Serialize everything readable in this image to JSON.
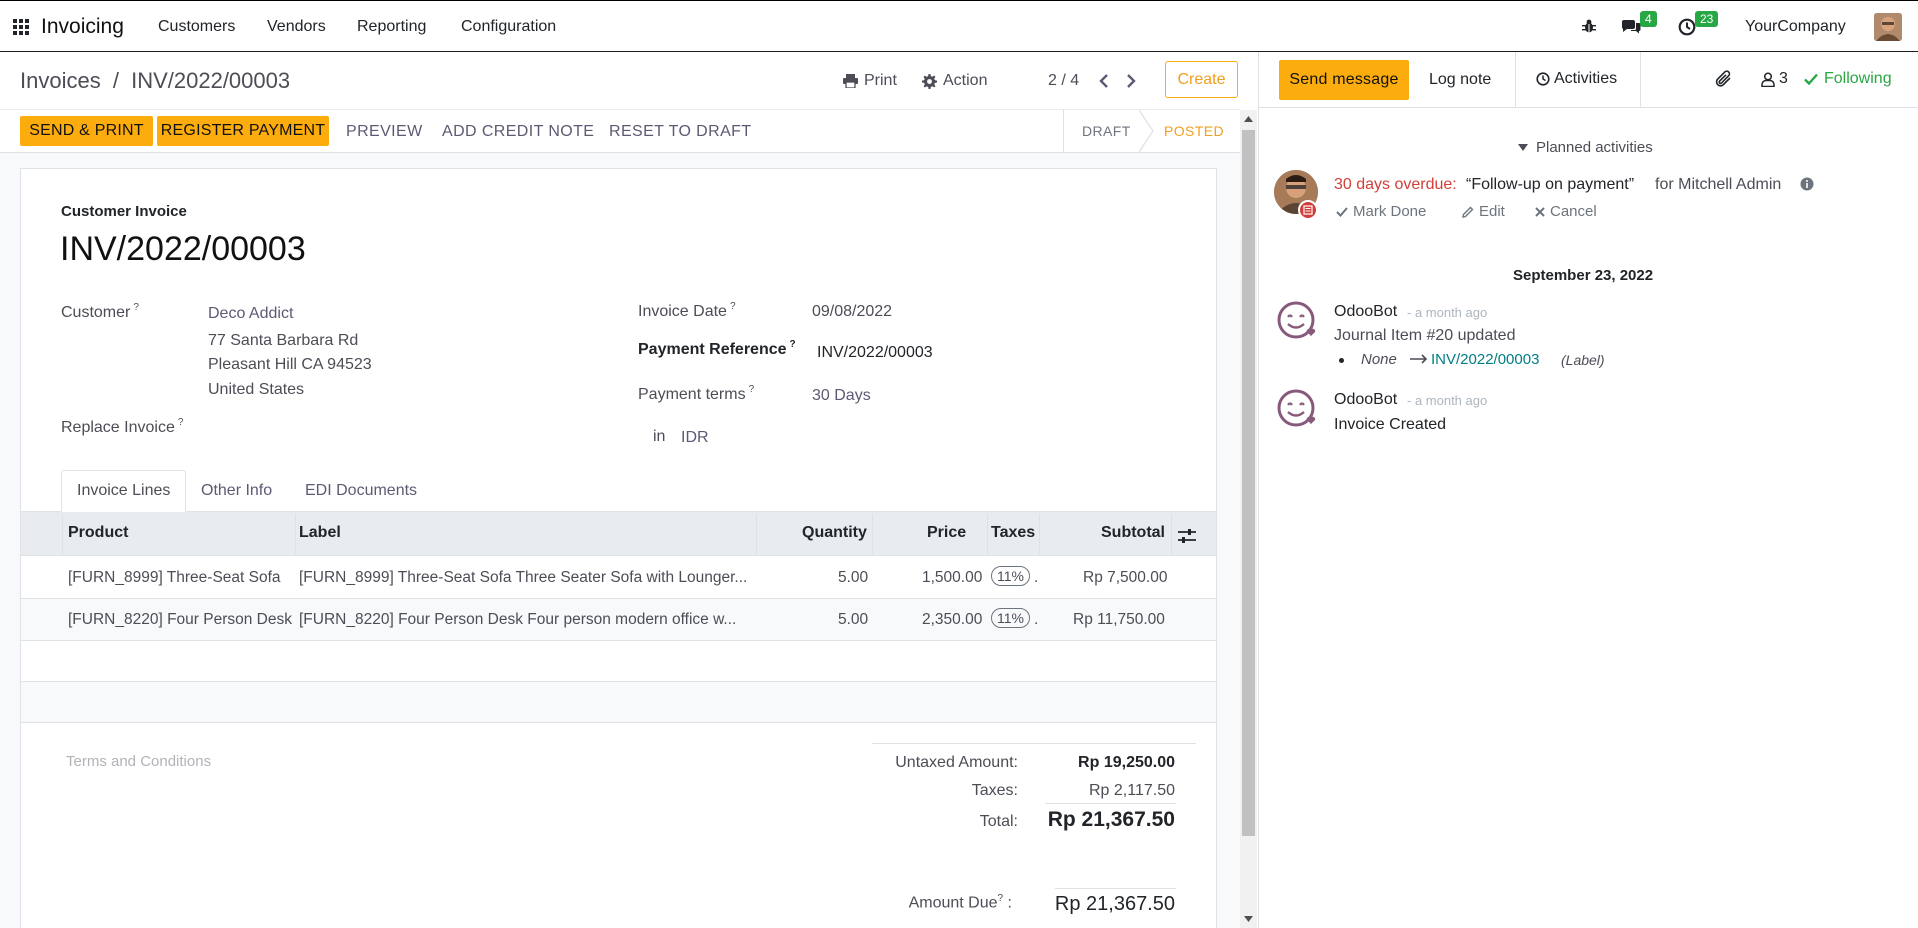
{
  "nav": {
    "app_name": "Invoicing",
    "menu": [
      "Customers",
      "Vendors",
      "Reporting",
      "Configuration"
    ],
    "messages_count": "4",
    "activities_count": "23",
    "company": "YourCompany"
  },
  "control": {
    "breadcrumb_parent": "Invoices",
    "breadcrumb_sep": "/",
    "breadcrumb_current": "INV/2022/00003",
    "print": "Print",
    "action": "Action",
    "pager": "2 / 4",
    "create": "Create"
  },
  "statusbar": {
    "send_print": "SEND & PRINT",
    "register_payment": "REGISTER PAYMENT",
    "preview": "PREVIEW",
    "add_credit_note": "ADD CREDIT NOTE",
    "reset_to_draft": "RESET TO DRAFT",
    "state_draft": "DRAFT",
    "state_posted": "POSTED"
  },
  "invoice": {
    "type_label": "Customer Invoice",
    "number": "INV/2022/00003",
    "customer_label": "Customer",
    "customer_name": "Deco Addict",
    "address_line1": "77 Santa Barbara Rd",
    "address_line2": "Pleasant Hill CA 94523",
    "address_line3": "United States",
    "replace_invoice_label": "Replace Invoice",
    "invoice_date_label": "Invoice Date",
    "invoice_date": "09/08/2022",
    "payment_reference_label": "Payment Reference",
    "payment_reference": "INV/2022/00003",
    "payment_terms_label": "Payment terms",
    "payment_terms": "30 Days",
    "currency_prefix": "in",
    "currency": "IDR",
    "help_mark": "?"
  },
  "tabs": [
    "Invoice Lines",
    "Other Info",
    "EDI Documents"
  ],
  "lines": {
    "headers": {
      "product": "Product",
      "label": "Label",
      "quantity": "Quantity",
      "price": "Price",
      "taxes": "Taxes",
      "subtotal": "Subtotal"
    },
    "rows": [
      {
        "product": "[FURN_8999] Three-Seat Sofa",
        "label": "[FURN_8999] Three-Seat Sofa Three Seater Sofa with Lounger...",
        "quantity": "5.00",
        "price": "1,500.00",
        "tax": "11%",
        "tax_suffix": ".",
        "subtotal": "Rp 7,500.00"
      },
      {
        "product": "[FURN_8220] Four Person Desk",
        "label": "[FURN_8220] Four Person Desk Four person modern office w...",
        "quantity": "5.00",
        "price": "2,350.00",
        "tax": "11%",
        "tax_suffix": ".",
        "subtotal": "Rp 11,750.00"
      }
    ]
  },
  "terms_placeholder": "Terms and Conditions",
  "totals": {
    "untaxed_label": "Untaxed Amount:",
    "untaxed": "Rp 19,250.00",
    "taxes_label": "Taxes:",
    "taxes": "Rp 2,117.50",
    "total_label": "Total:",
    "total": "Rp 21,367.50",
    "amount_due_label": "Amount Due",
    "amount_due_colon": ":",
    "amount_due": "Rp 21,367.50"
  },
  "chatter": {
    "send_message": "Send message",
    "log_note": "Log note",
    "activities": "Activities",
    "followers_count": "3",
    "following": "Following",
    "planned_activities": "Planned activities",
    "activity_overdue": "30 days overdue:",
    "activity_title": "“Follow-up on payment”",
    "activity_for": "for Mitchell Admin",
    "mark_done": "Mark Done",
    "edit": "Edit",
    "cancel": "Cancel",
    "date_separator": "September 23, 2022",
    "messages": [
      {
        "author": "OdooBot",
        "time": "- a month ago",
        "body": "Journal Item #20 updated",
        "change_old": "None",
        "change_new": "INV/2022/00003",
        "change_field": "(Label)"
      },
      {
        "author": "OdooBot",
        "time": "- a month ago",
        "body": "Invoice Created"
      }
    ]
  },
  "colors": {
    "accent": "#fcac0c",
    "posted": "#f0a020",
    "overdue": "#d23f3a",
    "following": "#28a745",
    "link": "#017e84",
    "badge": "#28a745"
  }
}
